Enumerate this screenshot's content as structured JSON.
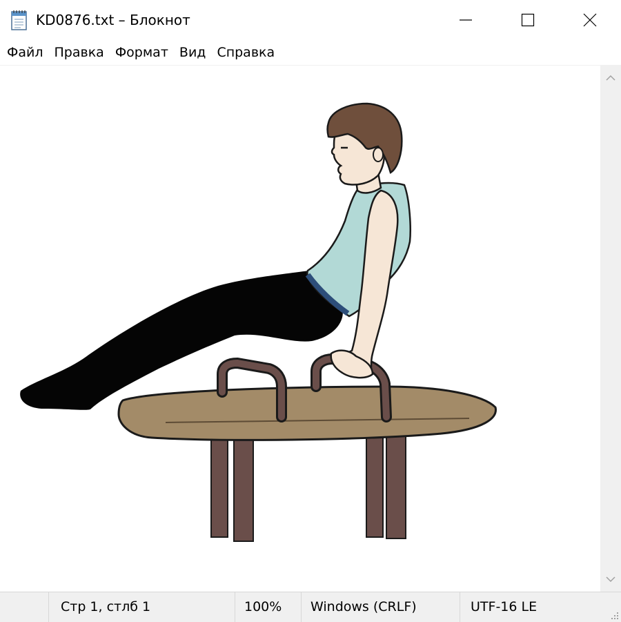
{
  "window": {
    "title": "KD0876.txt – Блокнот",
    "controls": [
      "minimize",
      "maximize",
      "close"
    ]
  },
  "menu": {
    "items": [
      {
        "label": "Файл"
      },
      {
        "label": "Правка"
      },
      {
        "label": "Формат"
      },
      {
        "label": "Вид"
      },
      {
        "label": "Справка"
      }
    ]
  },
  "document": {
    "content_type": "image",
    "colors": {
      "hair": "#6f4f3c",
      "skin": "#f6e6d6",
      "shirt": "#b2d9d6",
      "tights": "#050505",
      "horse_body": "#a38b68",
      "handles_legs": "#6a4e4a",
      "outline": "#1a1a1a"
    }
  },
  "statusbar": {
    "position": "Стр 1, стлб 1",
    "zoom": "100%",
    "line_endings": "Windows (CRLF)",
    "encoding": "UTF-16 LE"
  }
}
